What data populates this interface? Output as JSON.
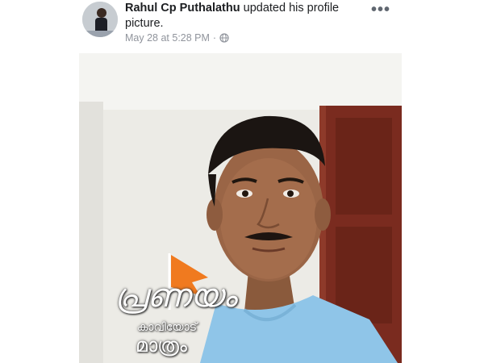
{
  "post": {
    "author": "Rahul Cp Puthalathu",
    "action": "updated his profile picture.",
    "timestamp": "May 28 at 5:28 PM",
    "separator": "·",
    "audience_icon": "globe-icon",
    "more_label": "•••"
  },
  "overlay": {
    "line1": "പ്രണയം",
    "line2": "കാവിയോട്",
    "line3": "മാത്രം"
  },
  "colors": {
    "saffron_flag": "#f07a1f",
    "shirt": "#8fc5e8",
    "door": "#7a2b1f",
    "wall": "#ecebe6"
  }
}
